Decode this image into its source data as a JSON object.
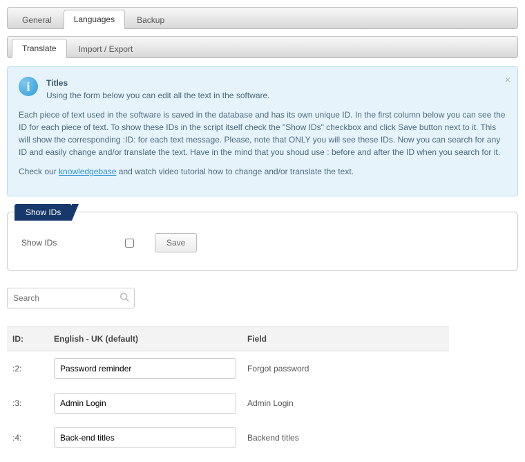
{
  "primary_tabs": [
    {
      "label": "General",
      "active": false
    },
    {
      "label": "Languages",
      "active": true
    },
    {
      "label": "Backup",
      "active": false
    }
  ],
  "secondary_tabs": [
    {
      "label": "Translate",
      "active": true
    },
    {
      "label": "Import / Export",
      "active": false
    }
  ],
  "info": {
    "title": "Titles",
    "subtitle": "Using the form below you can edit all the text in the software.",
    "para1": "Each piece of text used in the software is saved in the database and has its own unique ID. In the first column below you can see the ID for each piece of text. To show these IDs in the script itself check the \"Show IDs\" checkbox and click Save button next to it. This will show the corresponding :ID: for each text message. Please, note that ONLY you will see these IDs. Now you can search for any ID and easily change and/or translate the text. Have in the mind that you shoud use : before and after the ID when you search for it.",
    "para2_pre": "Check our ",
    "para2_link": "knowledgebase",
    "para2_post": " and watch video tutorial how to change and/or translate the text."
  },
  "showids": {
    "legend": "Show IDs",
    "label": "Show IDs",
    "save": "Save",
    "checked": false
  },
  "search": {
    "placeholder": "Search"
  },
  "table": {
    "headers": {
      "id": "ID:",
      "english": "English - UK (default)",
      "field": "Field"
    },
    "rows": [
      {
        "id": ":2:",
        "text": "Password reminder",
        "field": "Forgot password"
      },
      {
        "id": ":3:",
        "text": "Admin Login",
        "field": "Admin Login"
      },
      {
        "id": ":4:",
        "text": "Back-end titles",
        "field": "Backend titles"
      }
    ]
  }
}
